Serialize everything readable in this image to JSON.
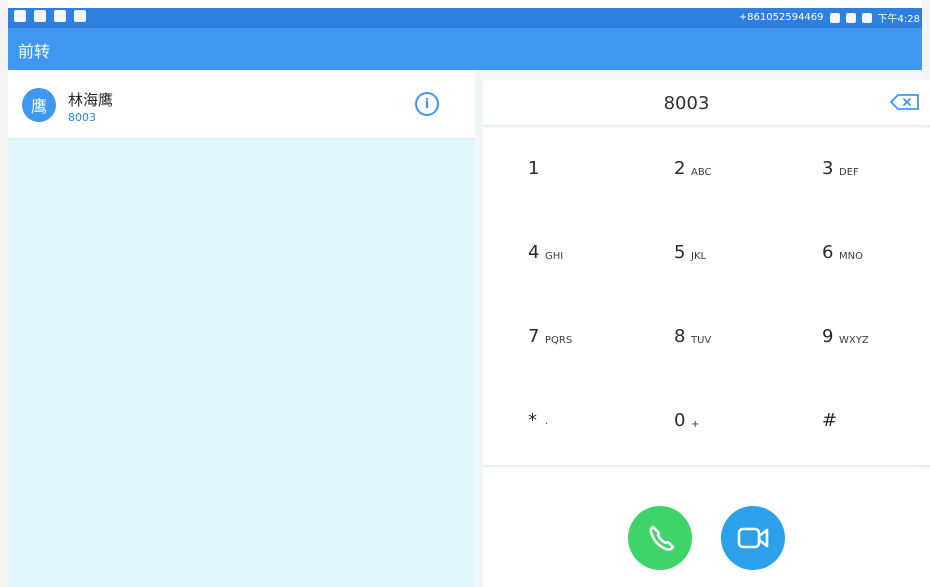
{
  "statusbar": {
    "phone": "+861052594469",
    "time": "下午4:28"
  },
  "appbar": {
    "title": "前转"
  },
  "contact": {
    "avatar_text": "鹰",
    "name": "林海鹰",
    "number": "8003"
  },
  "dialer": {
    "display_number": "8003",
    "keys": [
      {
        "digit": "1",
        "letters": ""
      },
      {
        "digit": "2",
        "letters": "ABC"
      },
      {
        "digit": "3",
        "letters": "DEF"
      },
      {
        "digit": "4",
        "letters": "GHI"
      },
      {
        "digit": "5",
        "letters": "JKL"
      },
      {
        "digit": "6",
        "letters": "MNO"
      },
      {
        "digit": "7",
        "letters": "PQRS"
      },
      {
        "digit": "8",
        "letters": "TUV"
      },
      {
        "digit": "9",
        "letters": "WXYZ"
      },
      {
        "digit": "*",
        "letters": "·"
      },
      {
        "digit": "0",
        "letters": "+"
      },
      {
        "digit": "#",
        "letters": ""
      }
    ]
  },
  "colors": {
    "statusbar": "#2f7fe0",
    "appbar": "#3f97f0",
    "left_panel": "#dff6fd",
    "call": "#3ed46a",
    "video": "#2da0ec"
  },
  "icons": {
    "info": "info-icon",
    "backspace": "backspace-icon",
    "call": "phone-icon",
    "video": "video-camera-icon"
  }
}
